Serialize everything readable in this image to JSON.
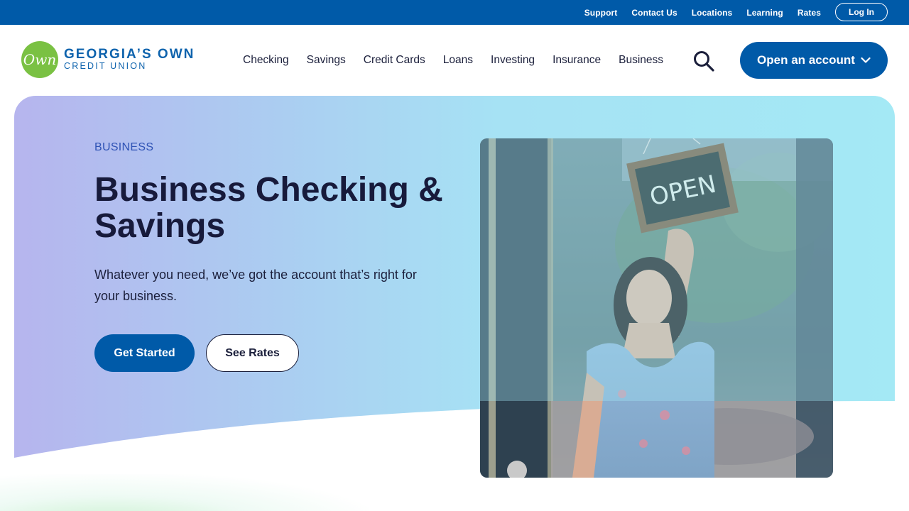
{
  "utility": {
    "links": [
      "Support",
      "Contact Us",
      "Locations",
      "Learning",
      "Rates"
    ],
    "login_label": "Log In"
  },
  "logo": {
    "mark": "Own",
    "line1": "GEORGIA’S OWN",
    "line2": "CREDIT UNION",
    "brand_green": "#7ac143",
    "brand_blue": "#0e63ad"
  },
  "nav": {
    "items": [
      "Checking",
      "Savings",
      "Credit Cards",
      "Loans",
      "Investing",
      "Insurance",
      "Business"
    ],
    "search_icon": "search-icon",
    "cta_label": "Open an account",
    "cta_icon": "chevron-down-icon"
  },
  "hero": {
    "eyebrow": "BUSINESS",
    "title": "Business Checking & Savings",
    "subtitle": "Whatever you need, we’ve got the account that’s right for your business.",
    "primary_button": "Get Started",
    "secondary_button": "See Rates",
    "photo_sign": "OPEN"
  },
  "colors": {
    "primary": "#005aa8",
    "text_dark": "#1b1f3b",
    "eyebrow": "#2f53b5"
  }
}
